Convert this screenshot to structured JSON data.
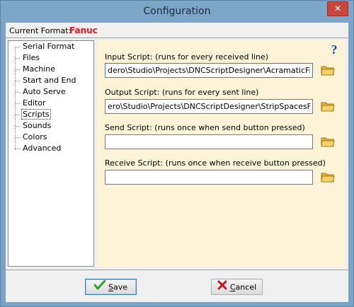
{
  "window": {
    "title": "Configuration",
    "close_symbol": "✕"
  },
  "format": {
    "label": "Current Format:",
    "value": "Fanuc"
  },
  "tree": {
    "items": [
      {
        "label": "Serial Format",
        "selected": false
      },
      {
        "label": "Files",
        "selected": false
      },
      {
        "label": "Machine",
        "selected": false
      },
      {
        "label": "Start and End",
        "selected": false
      },
      {
        "label": "Auto Serve",
        "selected": false
      },
      {
        "label": "Editor",
        "selected": false
      },
      {
        "label": "Scripts",
        "selected": true
      },
      {
        "label": "Sounds",
        "selected": false
      },
      {
        "label": "Colors",
        "selected": false
      },
      {
        "label": "Advanced",
        "selected": false
      }
    ]
  },
  "scripts": {
    "help_symbol": "?",
    "input": {
      "label": "Input Script: (runs for every received line)",
      "value": "dero\\Studio\\Projects\\DNCScriptDesigner\\AcramaticFilter.pcu"
    },
    "output": {
      "label": "Output Script: (runs for every sent line)",
      "value": "ero\\Studio\\Projects\\DNCScriptDesigner\\StripSpacesFilter.pcu"
    },
    "send": {
      "label": "Send Script: (runs once when send button pressed)",
      "value": ""
    },
    "receive": {
      "label": "Receive Script: (runs once when receive button pressed)",
      "value": ""
    }
  },
  "buttons": {
    "save": {
      "label_first": "S",
      "label_rest": "ave"
    },
    "cancel": {
      "label_first": "C",
      "label_rest": "ancel"
    }
  },
  "colors": {
    "content_background": "#fdf3d6",
    "format_value": "#e8151b",
    "titlebar": "#7ea6c9",
    "close_button": "#c9463d",
    "folder_icon": "#e8b432",
    "save_check": "#2e9e2e",
    "cancel_x": "#c4161c",
    "help_icon": "#1748b5"
  }
}
